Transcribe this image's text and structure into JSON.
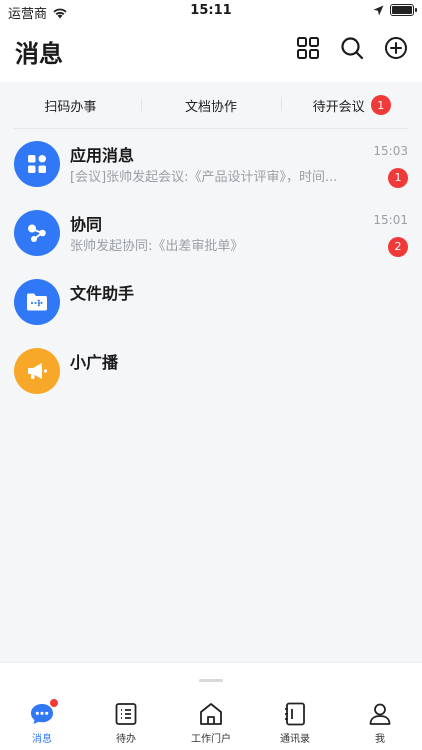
{
  "status_bar": {
    "carrier": "运营商",
    "time": "15:11"
  },
  "header": {
    "title": "消息",
    "icons": [
      "grid-icon",
      "search-icon",
      "add-circle-icon"
    ]
  },
  "quick_bar": {
    "items": [
      {
        "label": "扫码办事"
      },
      {
        "label": "文档协作"
      },
      {
        "label": "待开会议",
        "badge": "1"
      }
    ]
  },
  "conversations": [
    {
      "name": "应用消息",
      "preview": "[会议]张帅发起会议:《产品设计评审》，时间...",
      "time": "15:03",
      "badge": "1",
      "icon": "apps-icon",
      "color": "#3078f6"
    },
    {
      "name": "协同",
      "preview": "张帅发起协同:《出差审批单》",
      "time": "15:01",
      "badge": "2",
      "icon": "share-icon",
      "color": "#3078f6"
    },
    {
      "name": "文件助手",
      "icon": "folder-transfer-icon",
      "color": "#3078f6"
    },
    {
      "name": "小广播",
      "icon": "megaphone-icon",
      "color": "#f7a829"
    }
  ],
  "tabbar": {
    "tabs": [
      {
        "label": "消息",
        "icon": "message-icon",
        "active": true
      },
      {
        "label": "待办",
        "icon": "todo-list-icon"
      },
      {
        "label": "工作门户",
        "icon": "home-icon"
      },
      {
        "label": "通讯录",
        "icon": "contacts-book-icon"
      },
      {
        "label": "我",
        "icon": "person-icon"
      }
    ]
  },
  "colors": {
    "accent": "#3078f6",
    "badge": "#f03a3a",
    "broadcast": "#f7a829"
  }
}
